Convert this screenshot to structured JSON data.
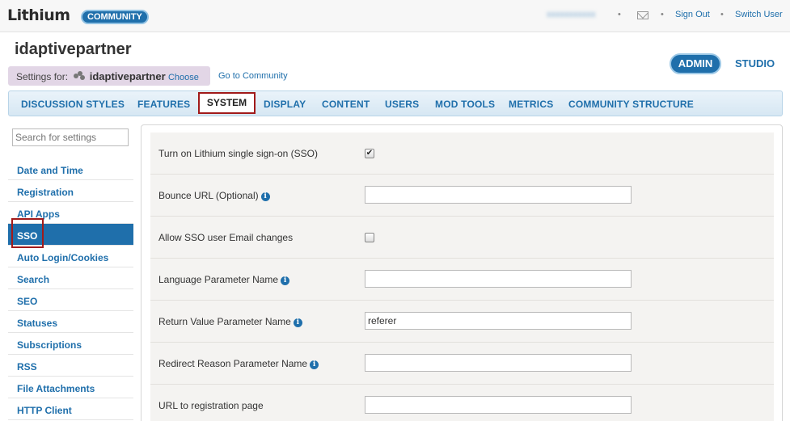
{
  "topbar": {
    "logo": "Lithium",
    "community_badge": "COMMUNITY",
    "username": "xxxxxxxxxxx",
    "sign_out": "Sign Out",
    "switch_user": "Switch User"
  },
  "header": {
    "title": "idaptivepartner",
    "settings_for_label": "Settings for:",
    "community_name": "idaptivepartner",
    "choose": "Choose",
    "go_to_community": "Go to Community",
    "admin": "ADMIN",
    "studio": "STUDIO"
  },
  "nav": {
    "items": [
      "DISCUSSION STYLES",
      "FEATURES",
      "SYSTEM",
      "DISPLAY",
      "CONTENT",
      "USERS",
      "MOD TOOLS",
      "METRICS",
      "COMMUNITY STRUCTURE"
    ],
    "active": "SYSTEM"
  },
  "sidebar": {
    "search_placeholder": "Search for settings",
    "items": [
      "Date and Time",
      "Registration",
      "API Apps",
      "SSO",
      "Auto Login/Cookies",
      "Search",
      "SEO",
      "Statuses",
      "Subscriptions",
      "RSS",
      "File Attachments",
      "HTTP Client"
    ],
    "active": "SSO"
  },
  "form": {
    "rows": [
      {
        "label": "Turn on Lithium single sign-on (SSO)",
        "type": "checkbox",
        "checked": true
      },
      {
        "label": "Bounce URL (Optional)",
        "type": "text",
        "info": true,
        "value": ""
      },
      {
        "label": "Allow SSO user Email changes",
        "type": "checkbox",
        "checked": false
      },
      {
        "label": "Language Parameter Name",
        "type": "text",
        "info": true,
        "value": ""
      },
      {
        "label": "Return Value Parameter Name",
        "type": "text",
        "info": true,
        "value": "referer"
      },
      {
        "label": "Redirect Reason Parameter Name",
        "type": "text",
        "info": true,
        "value": ""
      },
      {
        "label": "URL to registration page",
        "type": "text",
        "info": false,
        "value": ""
      }
    ],
    "checkmark": "✔",
    "info_glyph": "i"
  },
  "colors": {
    "accent": "#1f6fab",
    "highlight_border": "#a11a1a"
  }
}
